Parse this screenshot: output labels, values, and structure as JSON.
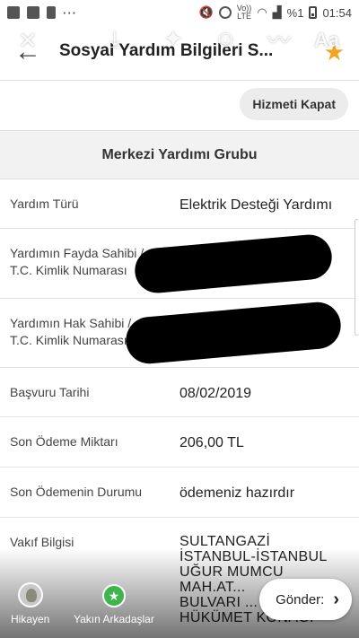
{
  "status_bar": {
    "icons_left": [
      "flash-icon",
      "image-icon",
      "sim-icon",
      "more-icon"
    ],
    "more": "···",
    "icons_right": [
      "mute-icon",
      "alarm-icon",
      "volte-icon",
      "wifi-icon",
      "signal-icon"
    ],
    "volte_line1": "Vo))",
    "volte_line2": "LTE",
    "battery": "%1",
    "time": "01:54"
  },
  "header": {
    "title": "Sosyal Yardım Bilgileri S...",
    "back_icon": "arrow-left-icon",
    "favorite_icon": "star-icon",
    "favorite_color": "#f2a41f"
  },
  "overlay_toolbar": {
    "icons": [
      "close-icon",
      "download-icon",
      "sparkle-icon",
      "sticker-icon",
      "draw-icon",
      "text-icon"
    ],
    "text_label": "Aa"
  },
  "actions": {
    "close_service_label": "Hizmeti Kapat"
  },
  "group_title": "Merkezi Yardımı Grubu",
  "rows": [
    {
      "label": "Yardım Türü",
      "value": "Elektrik Desteği Yardımı"
    },
    {
      "label": "Yardımın Fayda Sahibi /\nT.C. Kimlik Numarası",
      "value": ""
    },
    {
      "label": "Yardımın Hak Sahibi /\nT.C. Kimlik Numarası",
      "value": ""
    },
    {
      "label": "Başvuru Tarihi",
      "value": "08/02/2019"
    },
    {
      "label": "Son Ödeme Miktarı",
      "value": "206,00 TL"
    },
    {
      "label": "Son Ödemenin Durumu",
      "value": "ödemeniz hazırdır"
    },
    {
      "label": "Vakıf Bilgisi",
      "value": "SULTANGAZİ\nİSTANBUL-İSTANBUL\nUĞUR MUMCU\nMAH.AT...\nBULVARI ...\nHÜKÜMET KONAĞI"
    }
  ],
  "story_bar": {
    "story_label": "Hikayen",
    "friends_label": "Yakın Arkadaşlar",
    "send_label": "Gönder:",
    "friends_color": "#3db54a"
  }
}
